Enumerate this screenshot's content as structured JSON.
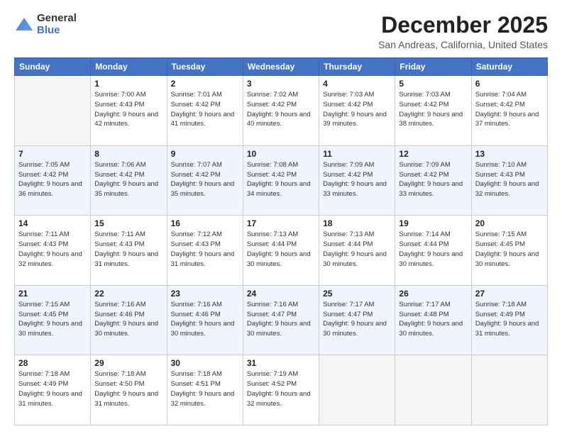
{
  "header": {
    "logo_general": "General",
    "logo_blue": "Blue",
    "title": "December 2025",
    "location": "San Andreas, California, United States"
  },
  "weekdays": [
    "Sunday",
    "Monday",
    "Tuesday",
    "Wednesday",
    "Thursday",
    "Friday",
    "Saturday"
  ],
  "weeks": [
    [
      {
        "day": "",
        "sunrise": "",
        "sunset": "",
        "daylight": "",
        "empty": true
      },
      {
        "day": "1",
        "sunrise": "Sunrise: 7:00 AM",
        "sunset": "Sunset: 4:43 PM",
        "daylight": "Daylight: 9 hours and 42 minutes."
      },
      {
        "day": "2",
        "sunrise": "Sunrise: 7:01 AM",
        "sunset": "Sunset: 4:42 PM",
        "daylight": "Daylight: 9 hours and 41 minutes."
      },
      {
        "day": "3",
        "sunrise": "Sunrise: 7:02 AM",
        "sunset": "Sunset: 4:42 PM",
        "daylight": "Daylight: 9 hours and 40 minutes."
      },
      {
        "day": "4",
        "sunrise": "Sunrise: 7:03 AM",
        "sunset": "Sunset: 4:42 PM",
        "daylight": "Daylight: 9 hours and 39 minutes."
      },
      {
        "day": "5",
        "sunrise": "Sunrise: 7:03 AM",
        "sunset": "Sunset: 4:42 PM",
        "daylight": "Daylight: 9 hours and 38 minutes."
      },
      {
        "day": "6",
        "sunrise": "Sunrise: 7:04 AM",
        "sunset": "Sunset: 4:42 PM",
        "daylight": "Daylight: 9 hours and 37 minutes."
      }
    ],
    [
      {
        "day": "7",
        "sunrise": "Sunrise: 7:05 AM",
        "sunset": "Sunset: 4:42 PM",
        "daylight": "Daylight: 9 hours and 36 minutes."
      },
      {
        "day": "8",
        "sunrise": "Sunrise: 7:06 AM",
        "sunset": "Sunset: 4:42 PM",
        "daylight": "Daylight: 9 hours and 35 minutes."
      },
      {
        "day": "9",
        "sunrise": "Sunrise: 7:07 AM",
        "sunset": "Sunset: 4:42 PM",
        "daylight": "Daylight: 9 hours and 35 minutes."
      },
      {
        "day": "10",
        "sunrise": "Sunrise: 7:08 AM",
        "sunset": "Sunset: 4:42 PM",
        "daylight": "Daylight: 9 hours and 34 minutes."
      },
      {
        "day": "11",
        "sunrise": "Sunrise: 7:09 AM",
        "sunset": "Sunset: 4:42 PM",
        "daylight": "Daylight: 9 hours and 33 minutes."
      },
      {
        "day": "12",
        "sunrise": "Sunrise: 7:09 AM",
        "sunset": "Sunset: 4:42 PM",
        "daylight": "Daylight: 9 hours and 33 minutes."
      },
      {
        "day": "13",
        "sunrise": "Sunrise: 7:10 AM",
        "sunset": "Sunset: 4:43 PM",
        "daylight": "Daylight: 9 hours and 32 minutes."
      }
    ],
    [
      {
        "day": "14",
        "sunrise": "Sunrise: 7:11 AM",
        "sunset": "Sunset: 4:43 PM",
        "daylight": "Daylight: 9 hours and 32 minutes."
      },
      {
        "day": "15",
        "sunrise": "Sunrise: 7:11 AM",
        "sunset": "Sunset: 4:43 PM",
        "daylight": "Daylight: 9 hours and 31 minutes."
      },
      {
        "day": "16",
        "sunrise": "Sunrise: 7:12 AM",
        "sunset": "Sunset: 4:43 PM",
        "daylight": "Daylight: 9 hours and 31 minutes."
      },
      {
        "day": "17",
        "sunrise": "Sunrise: 7:13 AM",
        "sunset": "Sunset: 4:44 PM",
        "daylight": "Daylight: 9 hours and 30 minutes."
      },
      {
        "day": "18",
        "sunrise": "Sunrise: 7:13 AM",
        "sunset": "Sunset: 4:44 PM",
        "daylight": "Daylight: 9 hours and 30 minutes."
      },
      {
        "day": "19",
        "sunrise": "Sunrise: 7:14 AM",
        "sunset": "Sunset: 4:44 PM",
        "daylight": "Daylight: 9 hours and 30 minutes."
      },
      {
        "day": "20",
        "sunrise": "Sunrise: 7:15 AM",
        "sunset": "Sunset: 4:45 PM",
        "daylight": "Daylight: 9 hours and 30 minutes."
      }
    ],
    [
      {
        "day": "21",
        "sunrise": "Sunrise: 7:15 AM",
        "sunset": "Sunset: 4:45 PM",
        "daylight": "Daylight: 9 hours and 30 minutes."
      },
      {
        "day": "22",
        "sunrise": "Sunrise: 7:16 AM",
        "sunset": "Sunset: 4:46 PM",
        "daylight": "Daylight: 9 hours and 30 minutes."
      },
      {
        "day": "23",
        "sunrise": "Sunrise: 7:16 AM",
        "sunset": "Sunset: 4:46 PM",
        "daylight": "Daylight: 9 hours and 30 minutes."
      },
      {
        "day": "24",
        "sunrise": "Sunrise: 7:16 AM",
        "sunset": "Sunset: 4:47 PM",
        "daylight": "Daylight: 9 hours and 30 minutes."
      },
      {
        "day": "25",
        "sunrise": "Sunrise: 7:17 AM",
        "sunset": "Sunset: 4:47 PM",
        "daylight": "Daylight: 9 hours and 30 minutes."
      },
      {
        "day": "26",
        "sunrise": "Sunrise: 7:17 AM",
        "sunset": "Sunset: 4:48 PM",
        "daylight": "Daylight: 9 hours and 30 minutes."
      },
      {
        "day": "27",
        "sunrise": "Sunrise: 7:18 AM",
        "sunset": "Sunset: 4:49 PM",
        "daylight": "Daylight: 9 hours and 31 minutes."
      }
    ],
    [
      {
        "day": "28",
        "sunrise": "Sunrise: 7:18 AM",
        "sunset": "Sunset: 4:49 PM",
        "daylight": "Daylight: 9 hours and 31 minutes."
      },
      {
        "day": "29",
        "sunrise": "Sunrise: 7:18 AM",
        "sunset": "Sunset: 4:50 PM",
        "daylight": "Daylight: 9 hours and 31 minutes."
      },
      {
        "day": "30",
        "sunrise": "Sunrise: 7:18 AM",
        "sunset": "Sunset: 4:51 PM",
        "daylight": "Daylight: 9 hours and 32 minutes."
      },
      {
        "day": "31",
        "sunrise": "Sunrise: 7:19 AM",
        "sunset": "Sunset: 4:52 PM",
        "daylight": "Daylight: 9 hours and 32 minutes."
      },
      {
        "day": "",
        "sunrise": "",
        "sunset": "",
        "daylight": "",
        "empty": true
      },
      {
        "day": "",
        "sunrise": "",
        "sunset": "",
        "daylight": "",
        "empty": true
      },
      {
        "day": "",
        "sunrise": "",
        "sunset": "",
        "daylight": "",
        "empty": true
      }
    ]
  ]
}
